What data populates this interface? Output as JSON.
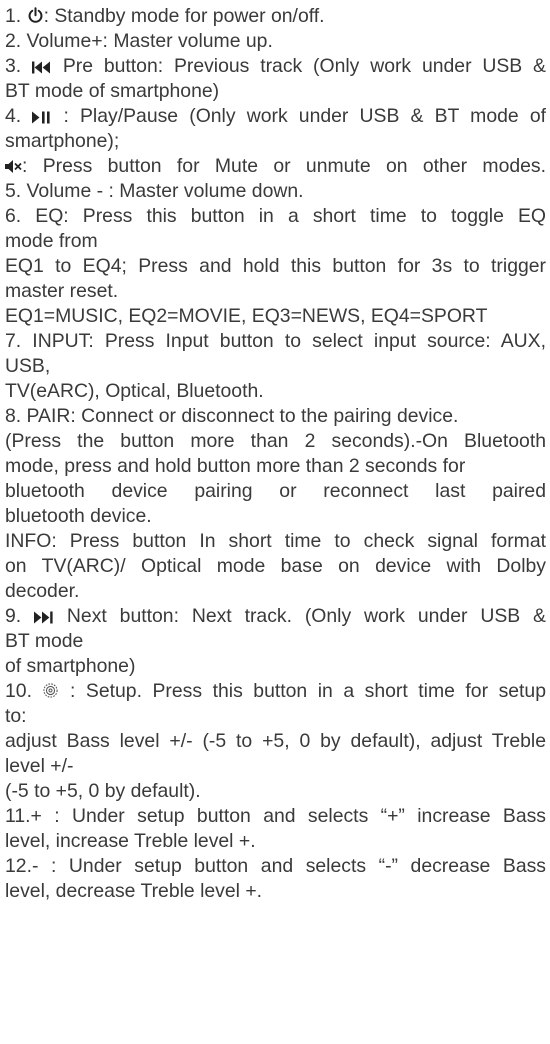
{
  "lines": [
    {
      "pre": "1. ",
      "post": ": Standby mode for power on/off."
    },
    {
      "text": "2. Volume+: Master volume up."
    },
    {
      "pre": "3. ",
      "post": " Pre button: Previous track (Only work under USB &"
    },
    {
      "text": "BT mode of smartphone)"
    },
    {
      "pre": "4. ",
      "post": " : Play/Pause (Only work under USB & BT mode of"
    },
    {
      "text": "smartphone);"
    },
    {
      "pre": "",
      "post": ": Press button for Mute or unmute on other modes."
    },
    {
      "text": "5. Volume - : Master volume down."
    },
    {
      "text": "6. EQ: Press this button in a short time to toggle EQ"
    },
    {
      "text": "mode from"
    },
    {
      "text": "EQ1 to EQ4; Press and hold this button for 3s to trigger"
    },
    {
      "text": "master reset."
    },
    {
      "text": "EQ1=MUSIC, EQ2=MOVIE, EQ3=NEWS, EQ4=SPORT"
    },
    {
      "text": "7. INPUT: Press Input button to select input source: AUX,"
    },
    {
      "text": "USB,"
    },
    {
      "text": "TV(eARC), Optical, Bluetooth."
    },
    {
      "text": "8. PAIR: Connect or disconnect to the pairing device."
    },
    {
      "text": "(Press the button more than 2 seconds).-On Bluetooth"
    },
    {
      "text": "mode, press and hold button more than 2 seconds for"
    },
    {
      "text": "bluetooth device pairing or reconnect last paired"
    },
    {
      "text": "bluetooth device."
    },
    {
      "text": "INFO: Press button In short time to check signal format"
    },
    {
      "text": "on TV(ARC)/ Optical mode base on device with Dolby"
    },
    {
      "text": "decoder."
    },
    {
      "pre": "9. ",
      "post": " Next button: Next track. (Only work under USB &"
    },
    {
      "text": "BT mode"
    },
    {
      "text": "of smartphone)"
    },
    {
      "pre": "10. ",
      "post": " : Setup. Press this button in a short time for setup"
    },
    {
      "text": "to:"
    },
    {
      "text": "adjust Bass level +/- (-5 to +5, 0 by default), adjust Treble"
    },
    {
      "text": "level +/-"
    },
    {
      "text": "(-5 to +5, 0 by default)."
    },
    {
      "text": "11.+ : Under setup button and selects “+”  increase Bass"
    },
    {
      "text": "level, increase Treble level +."
    },
    {
      "text": "12.- : Under setup button and selects “-”  decrease Bass"
    },
    {
      "text": "level, decrease Treble level +."
    }
  ],
  "icons": [
    "power-icon",
    "previous-track-icon",
    "play-pause-icon",
    "mute-icon",
    "next-track-icon",
    "setup-gear-icon"
  ]
}
